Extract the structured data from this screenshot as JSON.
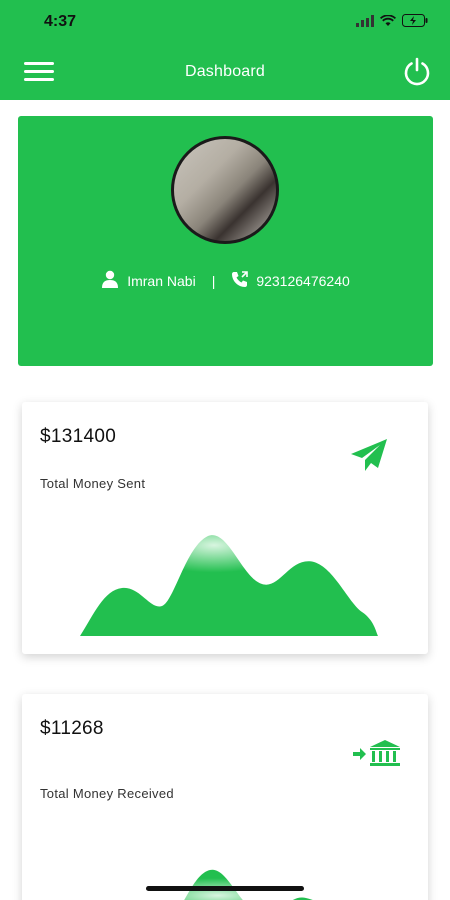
{
  "status_bar": {
    "time": "4:37"
  },
  "header": {
    "title": "Dashboard"
  },
  "profile": {
    "name": "Imran Nabi",
    "separator": "|",
    "phone": "923126476240"
  },
  "cards": [
    {
      "amount": "$131400",
      "label": "Total Money Sent",
      "icon": "paper-plane-icon"
    },
    {
      "amount": "$11268",
      "label": "Total Money Received",
      "icon": "bank-transfer-icon"
    }
  ],
  "colors": {
    "brand": "#22bf4f",
    "text": "#111111",
    "card": "#ffffff"
  }
}
